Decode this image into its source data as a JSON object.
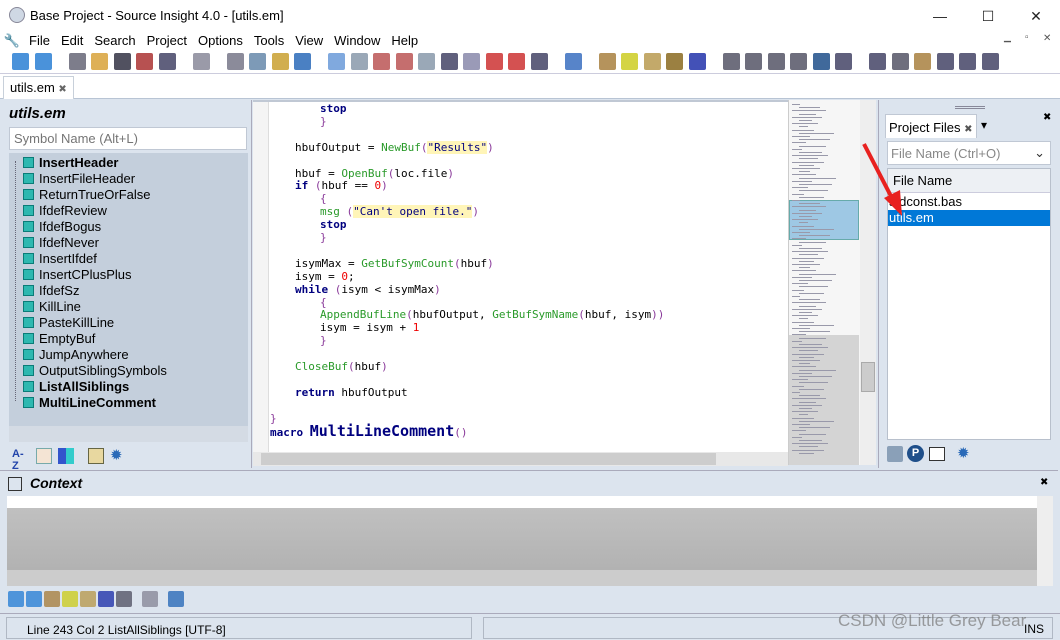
{
  "window": {
    "title": "Base Project - Source Insight 4.0 - [utils.em]",
    "minimize": "—",
    "maximize": "☐",
    "close": "✕"
  },
  "menu": [
    "File",
    "Edit",
    "Search",
    "Project",
    "Options",
    "Tools",
    "View",
    "Window",
    "Help"
  ],
  "mdi_controls": {
    "minimize": "▁",
    "restore": "▫",
    "close": "✕"
  },
  "toolbar_icons": [
    "back",
    "forward",
    "new-file",
    "open-file",
    "save",
    "save-as",
    "save-all",
    "print",
    "cut",
    "copy",
    "paste",
    "undo",
    "redo",
    "lookup",
    "jump-up",
    "jump-down",
    "search",
    "replace",
    "browse",
    "bookmark-prev",
    "bookmark-next",
    "relation",
    "context",
    "symbol-info",
    "symbol-window",
    "library",
    "references",
    "relation-window",
    "layout-1",
    "layout-2",
    "layout-3",
    "layout-4",
    "project",
    "context-window",
    "relation-tree",
    "clip",
    "activate",
    "browser",
    "overview",
    "window-list"
  ],
  "tabs": [
    {
      "label": "utils.em",
      "close": "✖"
    }
  ],
  "symbol_panel": {
    "title": "utils.em",
    "search_placeholder": "Symbol Name (Alt+L)",
    "symbols": [
      {
        "name": "InsertHeader",
        "bold": true
      },
      {
        "name": "InsertFileHeader",
        "bold": false
      },
      {
        "name": "ReturnTrueOrFalse",
        "bold": false
      },
      {
        "name": "IfdefReview",
        "bold": false
      },
      {
        "name": "IfdefBogus",
        "bold": false
      },
      {
        "name": "IfdefNever",
        "bold": false
      },
      {
        "name": "InsertIfdef",
        "bold": false
      },
      {
        "name": "InsertCPlusPlus",
        "bold": false
      },
      {
        "name": "IfdefSz",
        "bold": false
      },
      {
        "name": "KillLine",
        "bold": false
      },
      {
        "name": "PasteKillLine",
        "bold": false
      },
      {
        "name": "EmptyBuf",
        "bold": false
      },
      {
        "name": "JumpAnywhere",
        "bold": false
      },
      {
        "name": "OutputSiblingSymbols",
        "bold": false
      },
      {
        "name": "ListAllSiblings",
        "bold": true
      },
      {
        "name": "MultiLineComment",
        "bold": true
      }
    ],
    "bottom_tools": [
      {
        "icon": "sort-az",
        "label": "A-Z"
      },
      {
        "icon": "list-view"
      },
      {
        "icon": "category-view"
      },
      {
        "icon": "library"
      },
      {
        "icon": "gear"
      }
    ]
  },
  "editor": {
    "lines": [
      {
        "indent": 2,
        "tokens": [
          [
            "kw",
            "stop"
          ]
        ]
      },
      {
        "indent": 2,
        "tokens": [
          [
            "punc",
            "}"
          ]
        ]
      },
      {
        "indent": 0,
        "tokens": []
      },
      {
        "indent": 1,
        "tokens": [
          [
            "plain",
            "hbufOutput = "
          ],
          [
            "fn",
            "NewBuf"
          ],
          [
            "punc",
            "("
          ],
          [
            "str",
            "\"Results\""
          ],
          [
            "punc",
            ")"
          ]
        ]
      },
      {
        "indent": 0,
        "tokens": []
      },
      {
        "indent": 1,
        "tokens": [
          [
            "plain",
            "hbuf = "
          ],
          [
            "fn",
            "OpenBuf"
          ],
          [
            "punc",
            "("
          ],
          [
            "plain",
            "loc.file"
          ],
          [
            "punc",
            ")"
          ]
        ]
      },
      {
        "indent": 1,
        "tokens": [
          [
            "kw",
            "if"
          ],
          [
            "plain",
            " "
          ],
          [
            "punc",
            "("
          ],
          [
            "plain",
            "hbuf == "
          ],
          [
            "num",
            "0"
          ],
          [
            "punc",
            ")"
          ]
        ]
      },
      {
        "indent": 2,
        "tokens": [
          [
            "punc",
            "{"
          ]
        ]
      },
      {
        "indent": 2,
        "tokens": [
          [
            "fn",
            "msg"
          ],
          [
            "plain",
            " "
          ],
          [
            "punc",
            "("
          ],
          [
            "str",
            "\"Can't open file.\""
          ],
          [
            "punc",
            ")"
          ]
        ]
      },
      {
        "indent": 2,
        "tokens": [
          [
            "kw",
            "stop"
          ]
        ]
      },
      {
        "indent": 2,
        "tokens": [
          [
            "punc",
            "}"
          ]
        ]
      },
      {
        "indent": 0,
        "tokens": []
      },
      {
        "indent": 1,
        "tokens": [
          [
            "plain",
            "isymMax = "
          ],
          [
            "fn",
            "GetBufSymCount"
          ],
          [
            "punc",
            "("
          ],
          [
            "plain",
            "hbuf"
          ],
          [
            "punc",
            ")"
          ]
        ]
      },
      {
        "indent": 1,
        "tokens": [
          [
            "plain",
            "isym = "
          ],
          [
            "num",
            "0"
          ],
          [
            "plain",
            ";"
          ]
        ]
      },
      {
        "indent": 1,
        "tokens": [
          [
            "kw",
            "while"
          ],
          [
            "plain",
            " "
          ],
          [
            "punc",
            "("
          ],
          [
            "plain",
            "isym < isymMax"
          ],
          [
            "punc",
            ")"
          ]
        ]
      },
      {
        "indent": 2,
        "tokens": [
          [
            "punc",
            "{"
          ]
        ]
      },
      {
        "indent": 2,
        "tokens": [
          [
            "fn",
            "AppendBufLine"
          ],
          [
            "punc",
            "("
          ],
          [
            "plain",
            "hbufOutput, "
          ],
          [
            "fn",
            "GetBufSymName"
          ],
          [
            "punc",
            "("
          ],
          [
            "plain",
            "hbuf, isym"
          ],
          [
            "punc",
            "))"
          ]
        ]
      },
      {
        "indent": 2,
        "tokens": [
          [
            "plain",
            "isym = isym + "
          ],
          [
            "num",
            "1"
          ]
        ]
      },
      {
        "indent": 2,
        "tokens": [
          [
            "punc",
            "}"
          ]
        ]
      },
      {
        "indent": 0,
        "tokens": []
      },
      {
        "indent": 1,
        "tokens": [
          [
            "fn",
            "CloseBuf"
          ],
          [
            "punc",
            "("
          ],
          [
            "plain",
            "hbuf"
          ],
          [
            "punc",
            ")"
          ]
        ]
      },
      {
        "indent": 0,
        "tokens": []
      },
      {
        "indent": 1,
        "tokens": [
          [
            "kw",
            "return"
          ],
          [
            "plain",
            " hbufOutput"
          ]
        ]
      },
      {
        "indent": 0,
        "tokens": []
      },
      {
        "indent": 0,
        "tokens": [
          [
            "punc",
            "}"
          ]
        ]
      },
      {
        "indent": 0,
        "tokens": [
          [
            "kw",
            "macro "
          ],
          [
            "big",
            "MultiLineComment"
          ],
          [
            "punc",
            "()"
          ]
        ]
      }
    ]
  },
  "project_panel": {
    "tab_label": "Project Files",
    "tab_close": "✖",
    "dropdown": "▾",
    "panel_close": "✖",
    "search_placeholder": "File Name (Ctrl+O)",
    "column_header": "File Name",
    "files": [
      {
        "name": "stdconst.bas",
        "selected": false
      },
      {
        "name": "utils.em",
        "selected": true
      }
    ],
    "bottom_tools": [
      "open-project",
      "project-icon",
      "file-list",
      "gear"
    ]
  },
  "context_panel": {
    "title": "Context",
    "close": "✖",
    "tools": [
      "back",
      "forward",
      "jump",
      "symbol-info",
      "library",
      "references",
      "relation",
      "lock",
      "gear"
    ]
  },
  "status": {
    "text": "Line 243  Col 2  ListAllSiblings [UTF-8]",
    "mode": "INS"
  },
  "watermark": "CSDN @Little Grey Bear",
  "colors": {
    "accent": "#0078d7",
    "annotation_arrow": "#e8211f",
    "symbol_list_bg": "#c4cfdc"
  }
}
